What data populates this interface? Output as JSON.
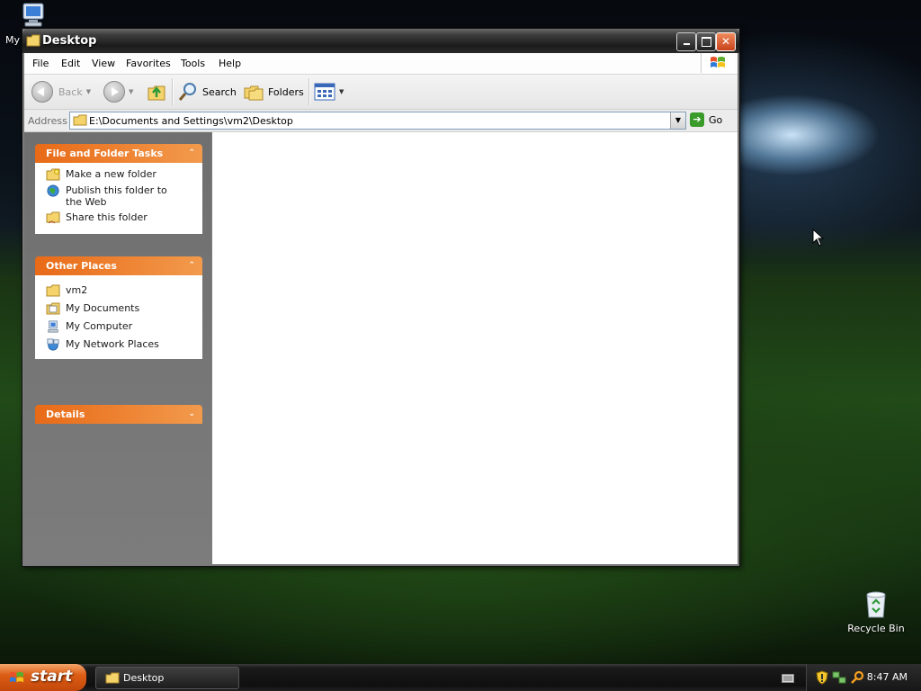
{
  "desktop": {
    "icons": [
      {
        "label": "My"
      },
      {
        "label": "Recycle Bin"
      }
    ]
  },
  "window": {
    "title": "Desktop",
    "menu": [
      "File",
      "Edit",
      "View",
      "Favorites",
      "Tools",
      "Help"
    ],
    "toolbar": {
      "back": "Back",
      "search": "Search",
      "folders": "Folders"
    },
    "address": {
      "label": "Address",
      "value": "E:\\Documents and Settings\\vm2\\Desktop",
      "go": "Go"
    },
    "panels": [
      {
        "title": "File and Folder Tasks",
        "items": [
          "Make a new folder",
          "Publish this folder to the Web",
          "Share this folder"
        ]
      },
      {
        "title": "Other Places",
        "items": [
          "vm2",
          "My Documents",
          "My Computer",
          "My Network Places"
        ]
      },
      {
        "title": "Details",
        "items": []
      }
    ]
  },
  "taskbar": {
    "start": "start",
    "tasks": [
      "Desktop"
    ],
    "clock": "8:47 AM"
  },
  "colors": {
    "panel_header": "#e86a17",
    "start_button": "#dc5e16",
    "taskbar": "#1a1a1a"
  }
}
